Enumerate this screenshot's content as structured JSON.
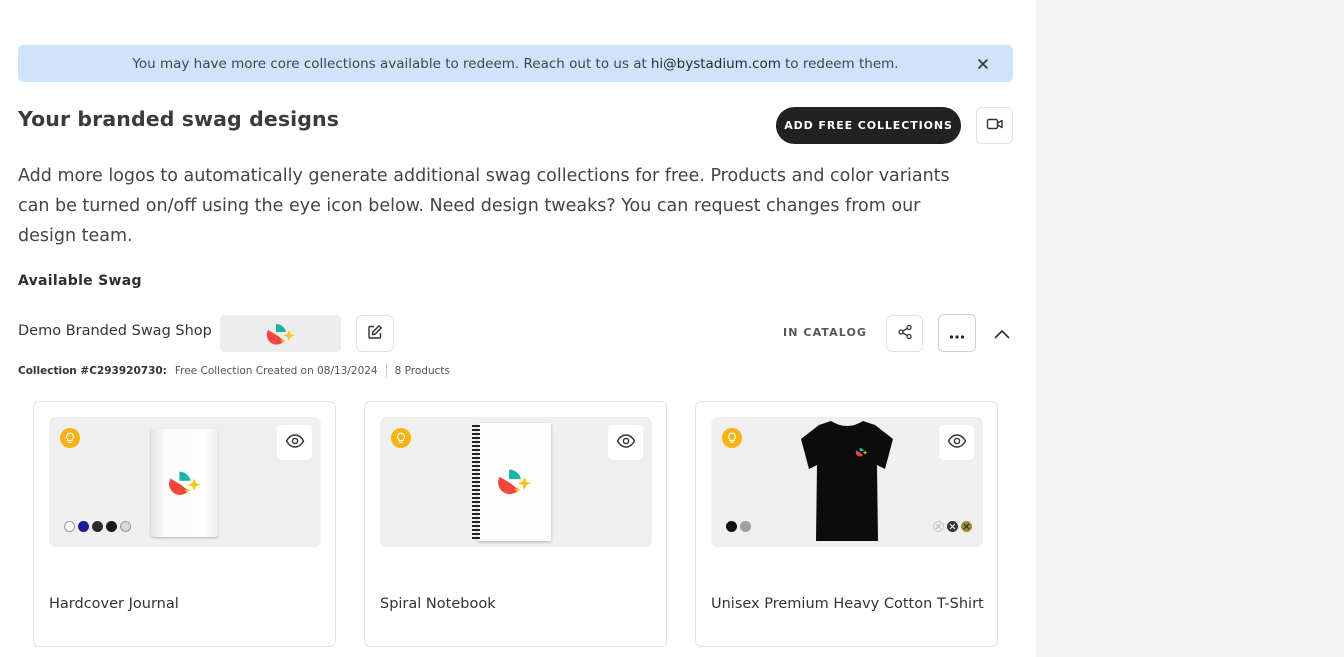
{
  "banner": {
    "text_before": "You may have more core collections available to redeem. Reach out to us at",
    "email": "hi@bystadium.com",
    "text_after": "to redeem them.",
    "close_icon": "close-icon"
  },
  "header": {
    "title": "Your branded swag designs",
    "add_button_label": "ADD FREE COLLECTIONS",
    "video_icon": "video-camera-icon"
  },
  "description": "Add more logos to automatically generate additional swag collections for free. Products and color variants can be turned on/off using the eye icon below. Need design tweaks? You can request changes from our design team.",
  "section_label": "Available Swag",
  "collection": {
    "shop_name": "Demo Branded Swag Shop",
    "status": "IN CATALOG",
    "collection_id": "Collection #C293920730:",
    "created": "Free Collection Created on 08/13/2024",
    "product_count": "8 Products",
    "logo_colors": {
      "teal": "#1bb5a5",
      "red": "#f0463c",
      "yellow": "#f5c518"
    }
  },
  "products": [
    {
      "name": "Hardcover Journal",
      "swatches": [
        "#ffffff",
        "#1c1c9a",
        "#2a2a33",
        "#1a1a1a",
        "#d9d9d9"
      ]
    },
    {
      "name": "Spiral Notebook",
      "swatches": []
    },
    {
      "name": "Unisex Premium Heavy Cotton T-Shirt",
      "swatches": [
        "#111111",
        "#a0a0a0"
      ],
      "swatches_right": [
        "#eeeeee",
        "#333333",
        "#a08830"
      ]
    }
  ],
  "colors": {
    "accent_dark": "#222222",
    "banner_bg": "#cfe4fb",
    "bulb": "#f5b316"
  }
}
